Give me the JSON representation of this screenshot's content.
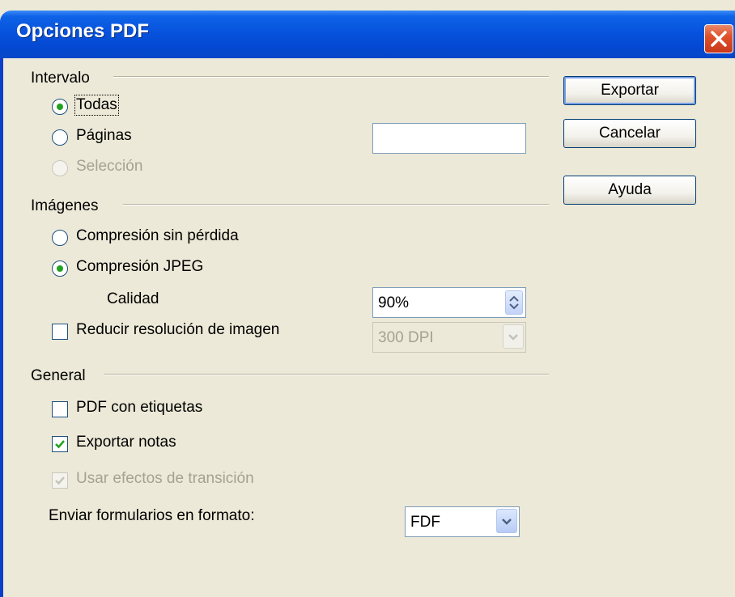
{
  "window": {
    "title": "Opciones PDF"
  },
  "buttons": {
    "export": "Exportar",
    "cancel": "Cancelar",
    "help": "Ayuda"
  },
  "range": {
    "heading": "Intervalo",
    "all": "Todas",
    "pages": "Páginas",
    "pages_value": "",
    "selection": "Selección",
    "selected": "all"
  },
  "images": {
    "heading": "Imágenes",
    "lossless": "Compresión sin pérdida",
    "jpeg": "Compresión JPEG",
    "selected": "jpeg",
    "quality_label": "Calidad",
    "quality_value": "90%",
    "reduce_resolution": "Reducir resolución de imagen",
    "reduce_resolution_checked": false,
    "resolution_value": "300 DPI"
  },
  "general": {
    "heading": "General",
    "tagged_pdf": "PDF con etiquetas",
    "tagged_pdf_checked": false,
    "export_notes": "Exportar notas",
    "export_notes_checked": true,
    "transition_effects": "Usar efectos de transición",
    "transition_effects_checked": true,
    "submit_format_label": "Enviar formularios en formato:",
    "submit_format_value": "FDF"
  },
  "colors": {
    "titlebar": "#0753de",
    "dialog_bg": "#ece9d8",
    "radio_dot": "#21a121",
    "check_mark": "#21a121"
  },
  "icons": {
    "close": "close-icon",
    "spin": "spin-arrows-icon",
    "dropdown": "chevron-down-icon",
    "check": "check-icon"
  }
}
